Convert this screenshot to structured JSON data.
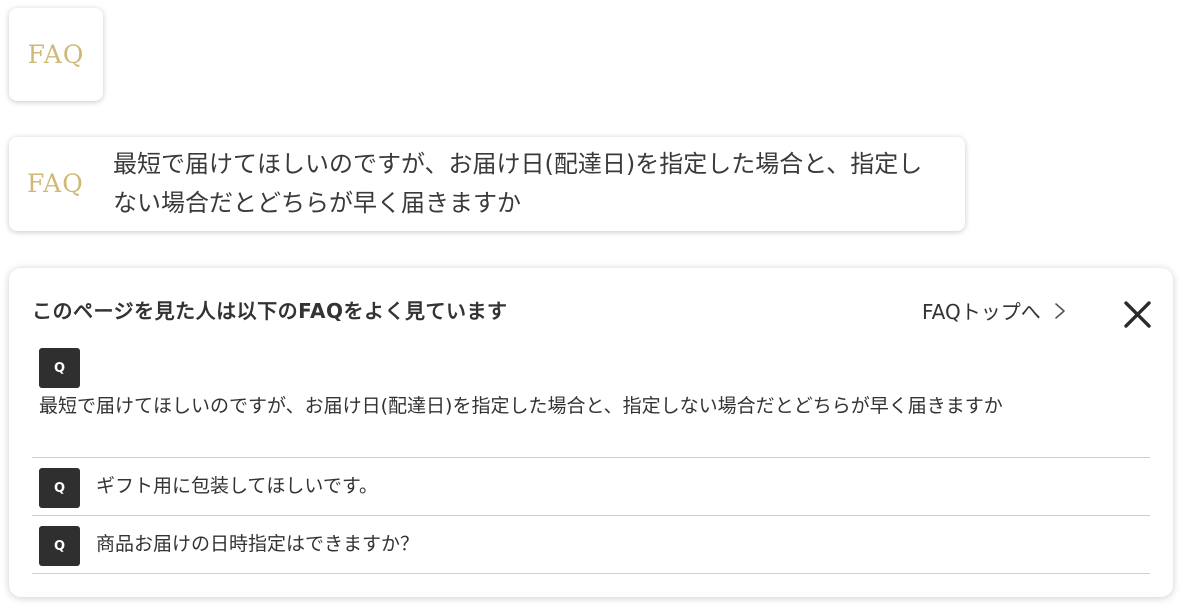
{
  "faq_badge": {
    "logo_text": "FAQ"
  },
  "question_card": {
    "logo_text": "FAQ",
    "question": "最短で届けてほしいのですが、お届け日(配達日)を指定した場合と、指定しない場合だとどちらが早く届きますか"
  },
  "panel": {
    "title": "このページを見た人は以下のFAQをよく見ています",
    "top_link_label": "FAQトップへ",
    "icons": {
      "chevron": "chevron-right-icon",
      "close": "close-icon"
    },
    "items": [
      {
        "badge": "Q",
        "text": "最短で届けてほしいのですが、お届け日(配達日)を指定した場合と、指定しない場合だとどちらが早く届きますか"
      },
      {
        "badge": "Q",
        "text": "ギフト用に包装してほしいです。"
      },
      {
        "badge": "Q",
        "text": "商品お届けの日時指定はできますか？"
      }
    ]
  },
  "colors": {
    "logo_gold": "#d0b878",
    "badge_dark": "#2f2f2f",
    "divider": "#cfcfcf",
    "text": "#333333"
  }
}
